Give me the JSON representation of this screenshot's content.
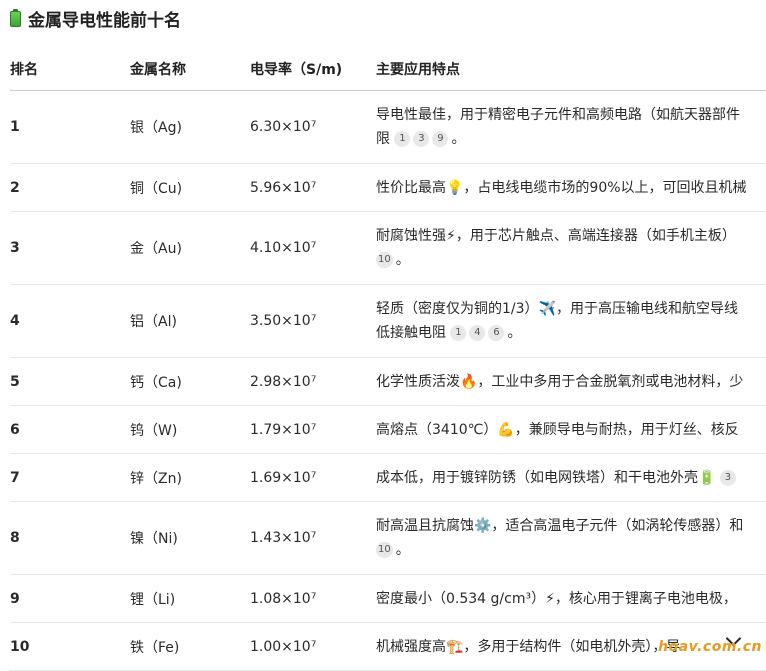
{
  "title": {
    "text": "金属导电性能前十名",
    "icon": "battery-icon"
  },
  "table": {
    "headers": [
      "排名",
      "金属名称",
      "电导率（S/m)",
      "主要应用特点"
    ],
    "rows": [
      {
        "rank": "1",
        "name": "银（Ag)",
        "cond": "6.30×10⁷",
        "line1": "导电性最佳，用于精密电子元件和高频电路（如航天器部件",
        "line2": "限",
        "cites": [
          "1",
          "3",
          "9"
        ],
        "tail": "。",
        "emoji": ""
      },
      {
        "rank": "2",
        "name": "铜（Cu)",
        "cond": "5.96×10⁷",
        "line1": "性价比最高💡，占电线电缆市场的90%以上，可回收且机械",
        "line2": "",
        "cites": [],
        "tail": "",
        "emoji": "lightbulb"
      },
      {
        "rank": "3",
        "name": "金（Au)",
        "cond": "4.10×10⁷",
        "line1": "耐腐蚀性强⚡，用于芯片触点、高端连接器（如手机主板）",
        "line2": "",
        "cites": [
          "10"
        ],
        "tail": "。",
        "emoji": "lightning"
      },
      {
        "rank": "4",
        "name": "铝（Al)",
        "cond": "3.50×10⁷",
        "line1": "轻质（密度仅为铜的1/3）✈️，用于高压输电线和航空导线",
        "line2": "低接触电阻",
        "cites": [
          "1",
          "4",
          "6"
        ],
        "tail": "。",
        "emoji": "airplane"
      },
      {
        "rank": "5",
        "name": "钙（Ca)",
        "cond": "2.98×10⁷",
        "line1": "化学性质活泼🔥，工业中多用于合金脱氧剂或电池材料，少",
        "line2": "",
        "cites": [],
        "tail": "",
        "emoji": "fire"
      },
      {
        "rank": "6",
        "name": "钨（W)",
        "cond": "1.79×10⁷",
        "line1": "高熔点（3410℃）💪，兼顾导电与耐热，用于灯丝、核反",
        "line2": "",
        "cites": [],
        "tail": "",
        "emoji": "muscle"
      },
      {
        "rank": "7",
        "name": "锌（Zn)",
        "cond": "1.69×10⁷",
        "line1": "成本低，用于镀锌防锈（如电网铁塔）和干电池外壳🔋",
        "line2": "",
        "cites": [
          "3"
        ],
        "tail": "",
        "emoji": "battery",
        "inline_cite": true
      },
      {
        "rank": "8",
        "name": "镍（Ni)",
        "cond": "1.43×10⁷",
        "line1": "耐高温且抗腐蚀⚙️，适合高温电子元件（如涡轮传感器）和",
        "line2": "",
        "cites": [
          "10"
        ],
        "tail": "。",
        "emoji": "gear"
      },
      {
        "rank": "9",
        "name": "锂（Li)",
        "cond": "1.08×10⁷",
        "line1": "密度最小（0.534 g/cm³）⚡，核心用于锂离子电池电极，",
        "line2": "",
        "cites": [],
        "tail": "",
        "emoji": "lightning"
      },
      {
        "rank": "10",
        "name": "铁（Fe)",
        "cond": "1.00×10⁷",
        "line1": "机械强度高🏗️，多用于结构件（如电机外壳），导",
        "line2": "",
        "cites": [],
        "tail": "",
        "emoji": "building"
      }
    ]
  },
  "watermark": "hoav.com.cn"
}
